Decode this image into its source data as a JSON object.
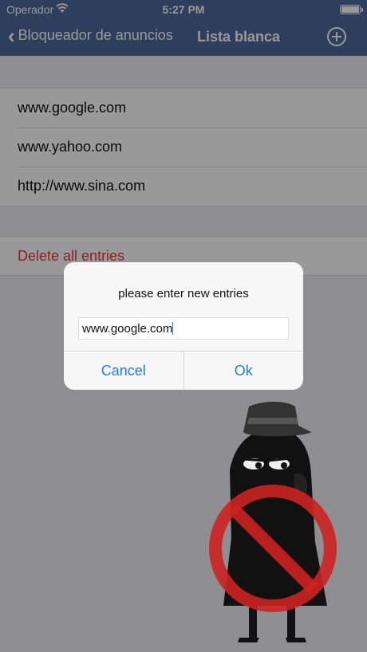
{
  "status": {
    "carrier": "Operador",
    "time": "5:27 PM"
  },
  "nav": {
    "back_label": "Bloqueador de anuncios",
    "title": "Lista blanca",
    "add_icon": "plus-circle-icon"
  },
  "whitelist": [
    "www.google.com",
    "www.yahoo.com",
    "http://www.sina.com"
  ],
  "delete_label": "Delete all entries",
  "alert": {
    "title": "please enter new entries",
    "input_value": "www.google.com",
    "cancel": "Cancel",
    "ok": "Ok"
  },
  "colors": {
    "nav_bar": "#4c6a9c",
    "destructive": "#e53b30",
    "link": "#1d7cf2",
    "forbidden": "#cc2222"
  }
}
